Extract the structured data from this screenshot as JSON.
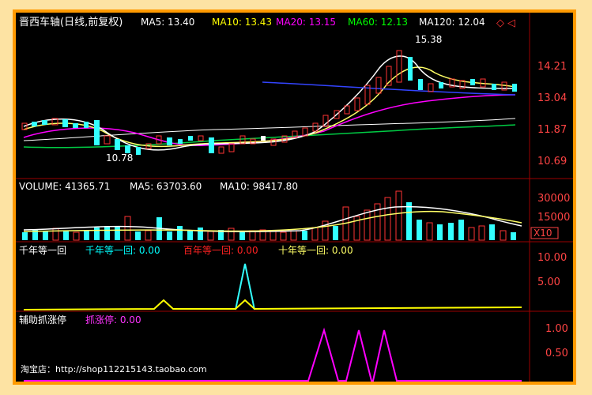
{
  "panels": {
    "price": {
      "title": "晋西车轴(日线,前复权)",
      "ma": [
        {
          "label": "MA5: 13.40",
          "color": "#ffffff"
        },
        {
          "label": "MA10: 13.43",
          "color": "#ffff00"
        },
        {
          "label": "MA20: 13.15",
          "color": "#ff00ff"
        },
        {
          "label": "MA60: 12.13",
          "color": "#00ff00"
        },
        {
          "label": "MA120: 12.04",
          "color": "#ffffff"
        }
      ],
      "axis": [
        "14.21",
        "13.04",
        "11.87",
        "10.69"
      ],
      "high_label": "15.38",
      "low_label": "10.78"
    },
    "volume": {
      "labels": [
        {
          "label": "VOLUME: 41365.71",
          "color": "#ffffff"
        },
        {
          "label": "MA5: 63703.60",
          "color": "#ffffff"
        },
        {
          "label": "MA10: 98417.80",
          "color": "#ffffff"
        }
      ],
      "axis": [
        "30000",
        "15000"
      ],
      "unit": "X10"
    },
    "indicator1": {
      "title": "千年等一回",
      "labels": [
        {
          "label": "千年等一回: 0.00",
          "color": "#00ffff"
        },
        {
          "label": "百年等一回: 0.00",
          "color": "#ff2222"
        },
        {
          "label": "十年等一回: 0.00",
          "color": "#ffff66"
        }
      ],
      "axis": [
        "10.00",
        "5.00"
      ]
    },
    "indicator2": {
      "title": "辅助抓涨停",
      "labels": [
        {
          "label": "抓涨停: 0.00",
          "color": "#ff33ff"
        }
      ],
      "axis": [
        "1.00",
        "0.50"
      ]
    }
  },
  "watermark": "淘宝店：http://shop112215143.taobao.com",
  "colors": {
    "up": "#ff3333",
    "down": "#33ffff",
    "frame": "#ff9a00",
    "grid": "#7a0000"
  }
}
